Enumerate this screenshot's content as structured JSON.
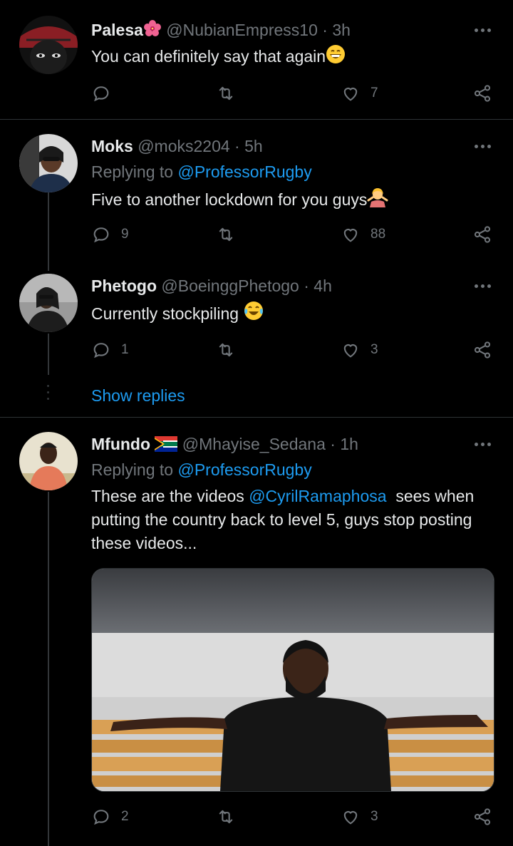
{
  "tweets": [
    {
      "name": "Palesa",
      "name_emoji": "hibiscus-emoji",
      "handle": "@NubianEmpress10",
      "sep": "·",
      "time": "3h",
      "text": "You can definitely say that again",
      "text_emoji": "grinning-emoji",
      "counts": {
        "replies": "",
        "retweets": "",
        "likes": "7"
      }
    },
    {
      "name": "Moks",
      "handle": "@moks2204",
      "sep": "·",
      "time": "5h",
      "replying_prefix": "Replying to",
      "replying_to": "@ProfessorRugby",
      "text": "Five to another lockdown for you guys",
      "text_emoji": "shrugging-emoji",
      "counts": {
        "replies": "9",
        "retweets": "",
        "likes": "88"
      }
    },
    {
      "name": "Phetogo",
      "handle": "@BoeinggPhetogo",
      "sep": "·",
      "time": "4h",
      "text": "Currently stockpiling",
      "text_emoji": "tears-of-joy-emoji",
      "counts": {
        "replies": "1",
        "retweets": "",
        "likes": "3"
      }
    },
    {
      "name": "Mfundo",
      "name_emoji": "south-africa-flag-emoji",
      "handle": "@Mhayise_Sedana",
      "sep": "·",
      "time": "1h",
      "replying_prefix": "Replying to",
      "replying_to": "@ProfessorRugby",
      "text_pre": "These are the videos ",
      "text_mention": "@CyrilRamaphosa",
      "text_post": "  sees when putting the country back to level 5, guys stop posting  these videos...",
      "counts": {
        "replies": "2",
        "retweets": "",
        "likes": "3"
      }
    }
  ],
  "show_replies": "Show replies",
  "colors": {
    "background": "#000000",
    "text": "#e7e9ea",
    "muted": "#71767b",
    "link": "#1d9bf0",
    "divider": "#2f3336"
  }
}
